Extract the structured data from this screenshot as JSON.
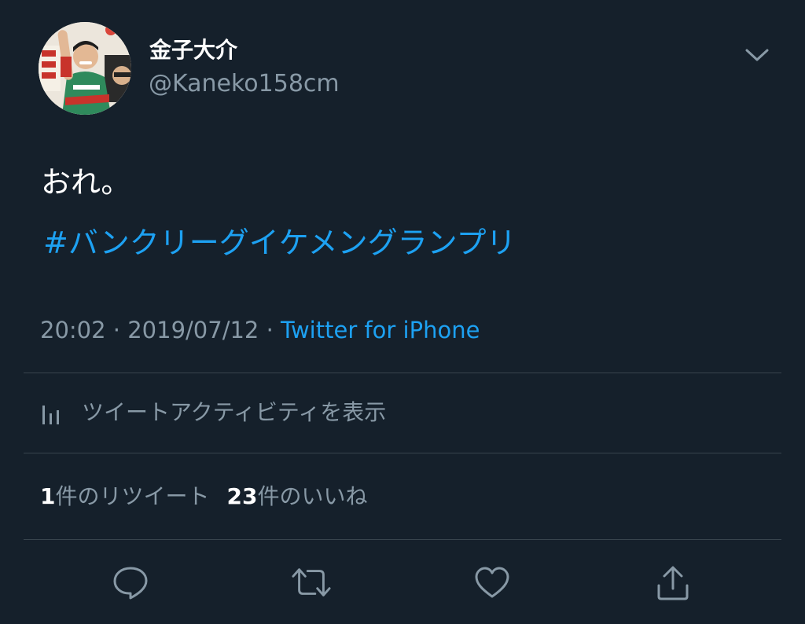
{
  "author": {
    "display_name": "金子大介",
    "handle": "@Kaneko158cm"
  },
  "tweet": {
    "text": "おれ。",
    "hashtag": "#バンクリーグイケメングランプリ",
    "time": "20:02",
    "separator": " · ",
    "date": "2019/07/12",
    "source": "Twitter for iPhone"
  },
  "activity": {
    "label": "ツイートアクティビティを表示",
    "icon": "bar-chart-icon"
  },
  "stats": {
    "retweet_count": "1",
    "retweet_label": "件のリツイート",
    "like_count": "23",
    "like_label": "件のいいね"
  },
  "actions": {
    "icons": [
      "reply-icon",
      "retweet-icon",
      "like-icon",
      "share-icon"
    ]
  },
  "colors": {
    "background": "#15202b",
    "accent": "#1da1f2",
    "secondary_text": "#8899a6",
    "divider": "#38444d"
  }
}
